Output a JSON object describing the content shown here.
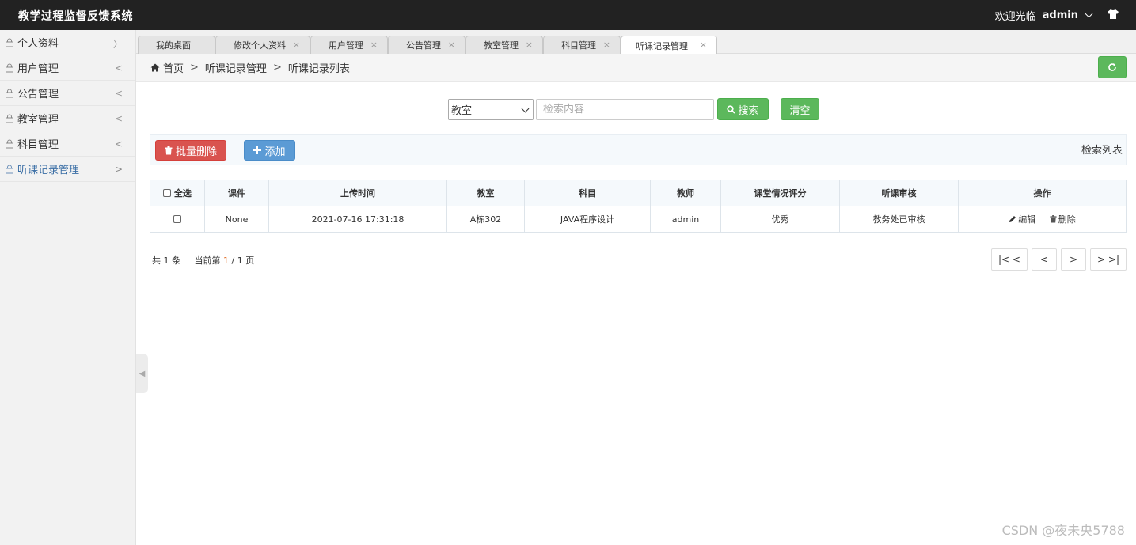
{
  "app": {
    "title": "教学过程监督反馈系统"
  },
  "header": {
    "welcome": "欢迎光临",
    "username": "admin",
    "theme_icon": "shirt-icon"
  },
  "sidebar": {
    "items": [
      {
        "label": "个人资料",
        "arrow": "﹀"
      },
      {
        "label": "用户管理",
        "arrow": "<"
      },
      {
        "label": "公告管理",
        "arrow": "<"
      },
      {
        "label": "教室管理",
        "arrow": "<"
      },
      {
        "label": "科目管理",
        "arrow": "<"
      },
      {
        "label": "听课记录管理",
        "arrow": ">"
      }
    ]
  },
  "tabs": [
    {
      "label": "我的桌面"
    },
    {
      "label": "修改个人资料"
    },
    {
      "label": "用户管理"
    },
    {
      "label": "公告管理"
    },
    {
      "label": "教室管理"
    },
    {
      "label": "科目管理"
    },
    {
      "label": "听课记录管理"
    }
  ],
  "tab_close": "×",
  "breadcrumb": {
    "home": "首页",
    "sep": ">",
    "level1": "听课记录管理",
    "level2": "听课记录列表"
  },
  "search": {
    "field_selected": "教室",
    "placeholder": "检索内容",
    "search_label": "搜索",
    "clear_label": "清空"
  },
  "toolbar": {
    "batch_delete": "批量删除",
    "add": "添加",
    "list_label": "检索列表"
  },
  "table": {
    "select_all": "全选",
    "columns": [
      "课件",
      "上传时间",
      "教室",
      "科目",
      "教师",
      "课堂情况评分",
      "听课审核",
      "操作"
    ],
    "rows": [
      {
        "courseware": "None",
        "upload_time": "2021-07-16 17:31:18",
        "classroom": "A栋302",
        "subject": "JAVA程序设计",
        "teacher": "admin",
        "rating": "优秀",
        "review": "教务处已审核",
        "edit": "编辑",
        "delete": "删除"
      }
    ]
  },
  "pagination": {
    "total_prefix": "共",
    "total": "1",
    "total_suffix": "条",
    "current_prefix": "当前第",
    "current": "1",
    "slash": "/",
    "pages": "1",
    "pages_suffix": "页",
    "first": "|< <",
    "prev": "<",
    "next": ">",
    "last": "> >|"
  },
  "watermark": "CSDN @夜未央5788",
  "colors": {
    "green": "#5cb85c",
    "red": "#d9534f",
    "blue": "#5b9bd5",
    "header": "#222222",
    "active_nav": "#3a6ea5"
  }
}
